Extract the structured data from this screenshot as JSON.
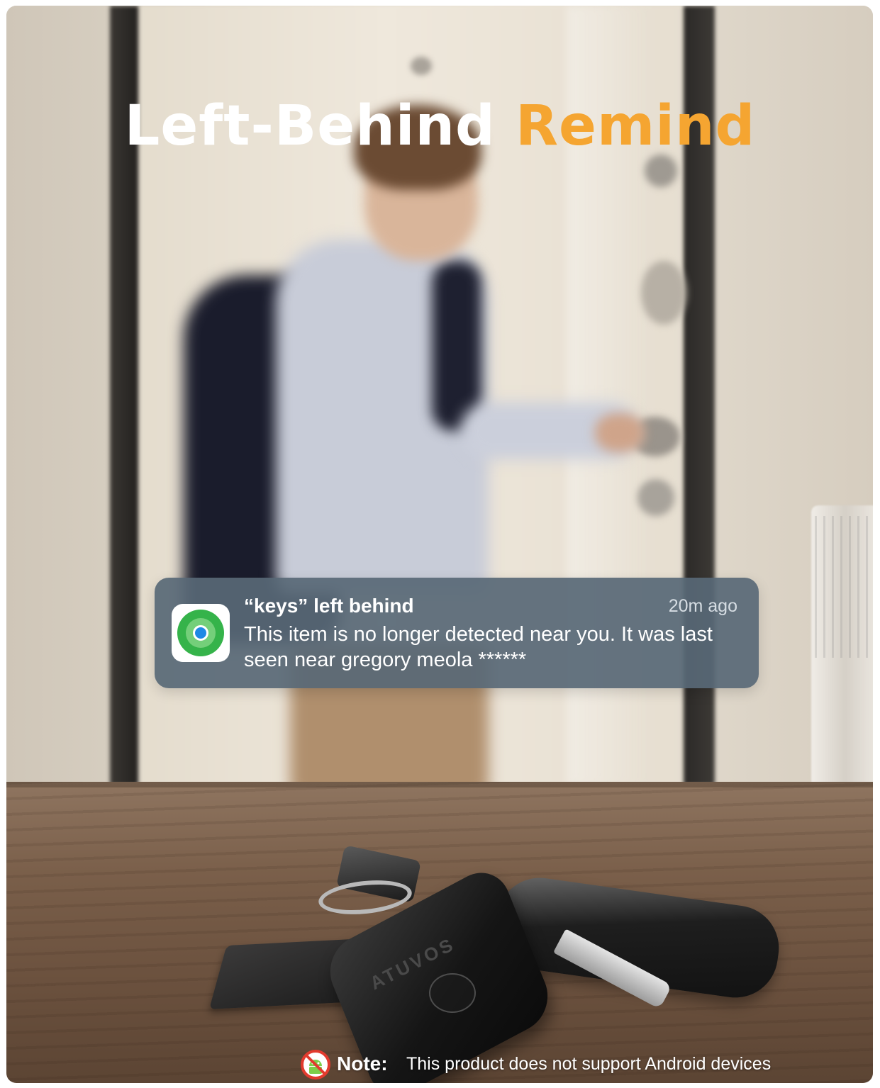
{
  "headline": {
    "part1": "Left-Behind",
    "part2": "Remind",
    "part1_color": "#ffffff",
    "part2_color": "#f5a531"
  },
  "notification": {
    "icon": "find-my-icon",
    "title": "“keys” left behind",
    "time": "20m ago",
    "body": "This item is no longer detected near you. It was last seen near  gregory meola ******"
  },
  "product": {
    "brand_on_tag": "ATUVOS"
  },
  "note": {
    "icon": "no-android-icon",
    "label": "Note:",
    "text": "This product does not support Android devices"
  }
}
